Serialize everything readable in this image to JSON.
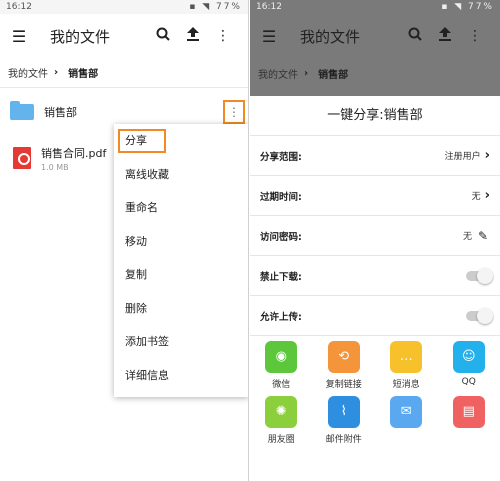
{
  "left": {
    "status": {
      "time": "16:12",
      "battery": "77%"
    },
    "appbar": {
      "title": "我的文件"
    },
    "breadcrumb": {
      "root": "我的文件",
      "current": "销售部"
    },
    "files": [
      {
        "name": "销售部",
        "type": "folder"
      },
      {
        "name": "销售合同.pdf",
        "size": "1.0 MB",
        "type": "pdf"
      }
    ],
    "context_menu": [
      "分享",
      "离线收藏",
      "重命名",
      "移动",
      "复制",
      "删除",
      "添加书签",
      "详细信息"
    ]
  },
  "right": {
    "status": {
      "time": "16:12",
      "battery": "77%"
    },
    "appbar": {
      "title": "我的文件"
    },
    "breadcrumb": {
      "root": "我的文件",
      "current": "销售部"
    },
    "share": {
      "title": "一键分享:销售部",
      "rows": [
        {
          "label": "分享范围:",
          "value": "注册用户"
        },
        {
          "label": "过期时间:",
          "value": "无"
        },
        {
          "label": "访问密码:",
          "value": "无"
        },
        {
          "label": "禁止下载:"
        },
        {
          "label": "允许上传:"
        }
      ],
      "targets": [
        {
          "label": "微信",
          "color": "#5dc73c",
          "icon": "wechat-icon"
        },
        {
          "label": "复制链接",
          "color": "#f4943b",
          "icon": "link-icon"
        },
        {
          "label": "短消息",
          "color": "#f7c12c",
          "icon": "message-icon"
        },
        {
          "label": "QQ",
          "color": "#24b0ea",
          "icon": "qq-icon"
        },
        {
          "label": "朋友圈",
          "color": "#8ccf3c",
          "icon": "moments-icon"
        },
        {
          "label": "邮件附件",
          "color": "#2e8fe0",
          "icon": "paperclip-icon"
        },
        {
          "label": "",
          "color": "#5aa9f0",
          "icon": "mail-icon"
        },
        {
          "label": "",
          "color": "#f06262",
          "icon": "note-icon"
        }
      ]
    }
  },
  "colors": {
    "highlight": "#f08a24",
    "folder": "#63b3ed",
    "overlay": "#7a7a7a"
  }
}
